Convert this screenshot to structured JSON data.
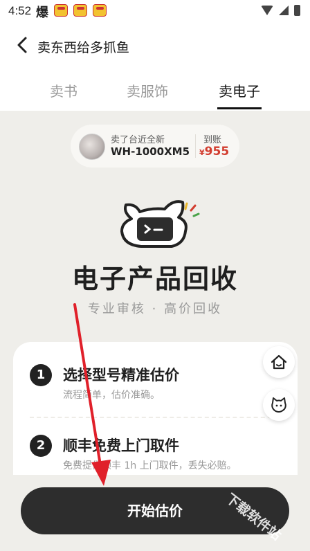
{
  "status": {
    "time": "4:52",
    "extra": "爆"
  },
  "header": {
    "title": "卖东西给多抓鱼"
  },
  "tabs": [
    {
      "label": "卖书",
      "active": false
    },
    {
      "label": "卖服饰",
      "active": false
    },
    {
      "label": "卖电子",
      "active": true
    }
  ],
  "recent_sale": {
    "line1": "卖了台近全新",
    "product": "WH-1000XM5",
    "received_label": "到账",
    "currency": "¥",
    "amount": "955"
  },
  "hero": {
    "headline": "电子产品回收",
    "subline": "专业审核 · 高价回收"
  },
  "steps": [
    {
      "num": "1",
      "title": "选择型号精准估价",
      "desc": "流程简单，估价准确。"
    },
    {
      "num": "2",
      "title": "顺丰免费上门取件",
      "desc": "免费提供顺丰 1h 上门取件，丢失必赔。"
    }
  ],
  "side_buttons": [
    {
      "icon": "home-icon"
    },
    {
      "icon": "cat-service-icon"
    }
  ],
  "cta": {
    "label": "开始估价"
  },
  "watermark": "下载软件站",
  "colors": {
    "accent_price": "#d23c2e",
    "button_dark": "#2d2d2d",
    "annotation_arrow": "#e0202a"
  }
}
